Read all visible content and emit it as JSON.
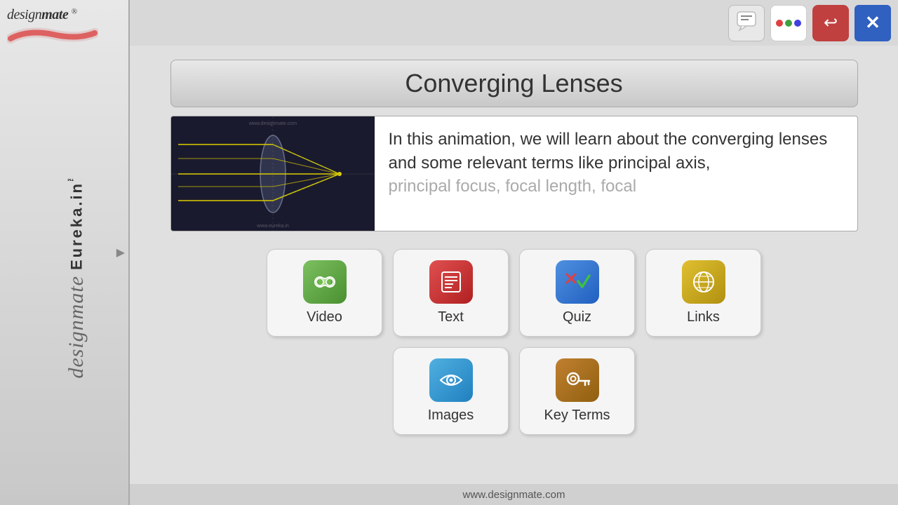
{
  "app": {
    "title": "Converging Lenses",
    "footer_url": "www.designmate.com",
    "brand_name": "designmate",
    "eureka_label": "Eureka.in™",
    "designmate_label": "designmate"
  },
  "topbar": {
    "chat_icon": "💬",
    "dots_label": "dots",
    "back_icon": "↩",
    "close_icon": "✕"
  },
  "preview": {
    "description_start": "In this animation, we will learn about the converging lenses and some relevant terms like principal axis,",
    "description_faded": "principal focus, focal length, focal"
  },
  "buttons": {
    "row1": [
      {
        "id": "video",
        "label": "Video",
        "icon": "🎬"
      },
      {
        "id": "text",
        "label": "Text",
        "icon": "📖"
      },
      {
        "id": "quiz",
        "label": "Quiz",
        "icon": "✅"
      },
      {
        "id": "links",
        "label": "Links",
        "icon": "🌐"
      }
    ],
    "row2": [
      {
        "id": "images",
        "label": "Images",
        "icon": "👁"
      },
      {
        "id": "keyterms",
        "label": "Key Terms",
        "icon": "🔑"
      }
    ]
  }
}
